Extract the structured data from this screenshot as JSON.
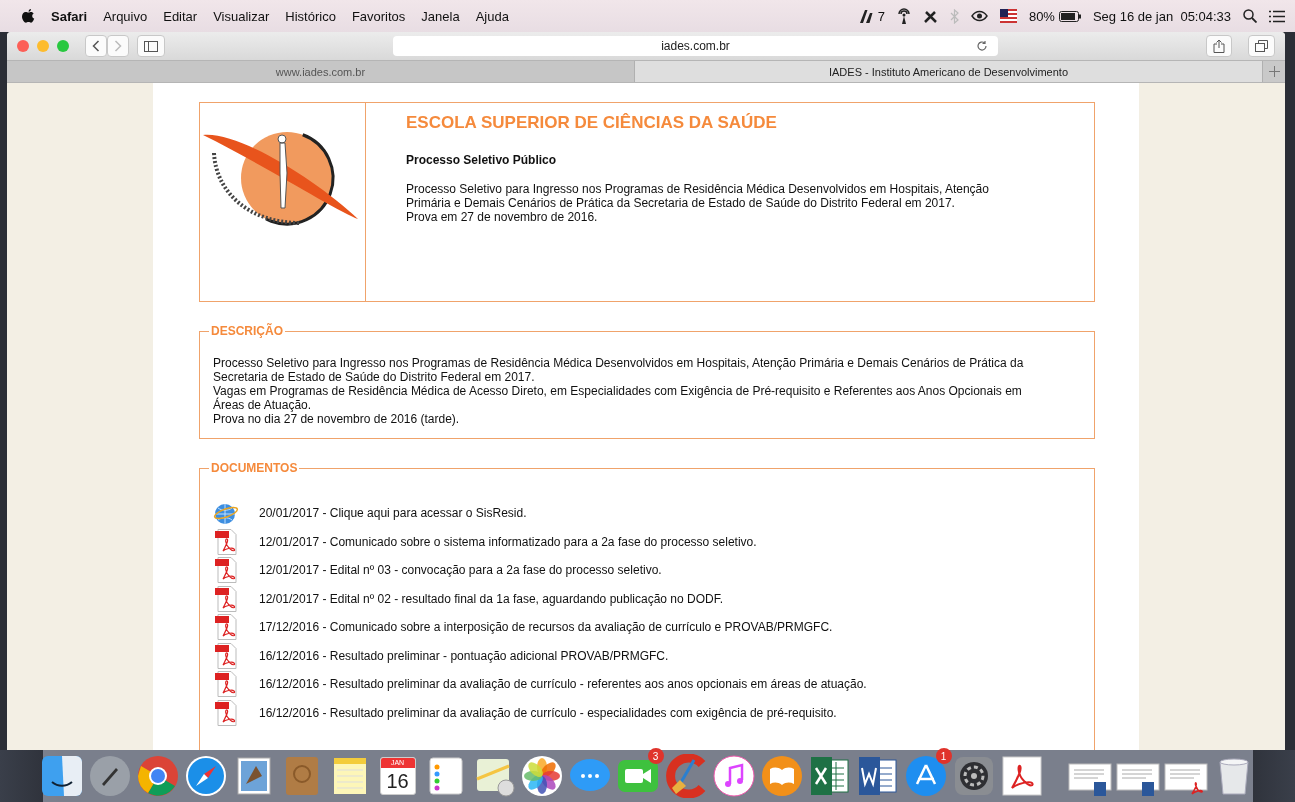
{
  "menu_bar": {
    "app": "Safari",
    "items": [
      "Arquivo",
      "Editar",
      "Visualizar",
      "Histórico",
      "Favoritos",
      "Janela",
      "Ajuda"
    ],
    "adobe_count": "7",
    "battery": "80%",
    "clock": "Seg 16 de jan  05:04:33"
  },
  "toolbar": {
    "url": "iades.com.br"
  },
  "tabs": [
    {
      "label": "www.iades.com.br",
      "selected": false
    },
    {
      "label": "IADES - Instituto Americano de Desenvolvimento",
      "selected": true
    }
  ],
  "header": {
    "title": "ESCOLA SUPERIOR DE CIÊNCIAS DA SAÚDE",
    "subtitle": "Processo Seletivo Público",
    "lines": [
      "Processo Seletivo para Ingresso nos Programas de Residência Médica Desenvolvidos em Hospitais, Atenção Primária e Demais Cenários de Prática da Secretaria de Estado de Saúde do Distrito Federal em 2017.",
      "Prova em 27 de novembro de 2016."
    ]
  },
  "description": {
    "legend": "DESCRIÇÃO",
    "lines": [
      "Processo Seletivo para Ingresso nos Programas de Residência Médica Desenvolvidos em Hospitais, Atenção Primária e Demais Cenários de Prática da Secretaria de Estado de Saúde do Distrito Federal em 2017.",
      "Vagas em Programas de Residência Médica de Acesso Direto, em Especialidades com Exigência de Pré-requisito e Referentes aos Anos Opcionais em Áreas de Atuação.",
      "Prova no dia 27 de novembro de 2016 (tarde)."
    ]
  },
  "documents": {
    "legend": "DOCUMENTOS",
    "items": [
      {
        "kind": "web",
        "text": "20/01/2017 - Clique aqui para acessar o SisResid."
      },
      {
        "kind": "pdf",
        "text": "12/01/2017 - Comunicado sobre o sistema informatizado para a 2a fase do processo seletivo."
      },
      {
        "kind": "pdf",
        "text": "12/01/2017 - Edital nº 03 - convocação para a 2a fase do processo seletivo."
      },
      {
        "kind": "pdf",
        "text": "12/01/2017 - Edital nº 02 - resultado final da 1a fase, aguardando publicação no DODF."
      },
      {
        "kind": "pdf",
        "text": "17/12/2016 - Comunicado sobre a interposição de recursos da avaliação de currículo e PROVAB/PRMGFC."
      },
      {
        "kind": "pdf",
        "text": "16/12/2016 - Resultado preliminar - pontuação adicional PROVAB/PRMGFC."
      },
      {
        "kind": "pdf",
        "text": "16/12/2016 - Resultado preliminar da avaliação de currículo - referentes aos anos opcionais em áreas de atuação."
      },
      {
        "kind": "pdf",
        "text": "16/12/2016 - Resultado preliminar da avaliação de currículo - especialidades com exigência de pré-requisito."
      }
    ]
  },
  "dock": {
    "items": [
      {
        "kind": "finder"
      },
      {
        "kind": "launchpad"
      },
      {
        "kind": "chrome"
      },
      {
        "kind": "safari"
      },
      {
        "kind": "mail"
      },
      {
        "kind": "contacts"
      },
      {
        "kind": "notes"
      },
      {
        "kind": "calendar",
        "month": "JAN",
        "day": "16"
      },
      {
        "kind": "reminders"
      },
      {
        "kind": "maps"
      },
      {
        "kind": "photos"
      },
      {
        "kind": "messages"
      },
      {
        "kind": "facetime",
        "badge": "3"
      },
      {
        "kind": "cleaner"
      },
      {
        "kind": "music"
      },
      {
        "kind": "books"
      },
      {
        "kind": "excel"
      },
      {
        "kind": "word"
      },
      {
        "kind": "appstore",
        "badge": "1"
      },
      {
        "kind": "preferences"
      },
      {
        "kind": "acrobat"
      },
      {
        "kind": "separator"
      },
      {
        "kind": "word-doc"
      },
      {
        "kind": "word-doc"
      },
      {
        "kind": "pdf-doc"
      },
      {
        "kind": "trash"
      }
    ]
  }
}
